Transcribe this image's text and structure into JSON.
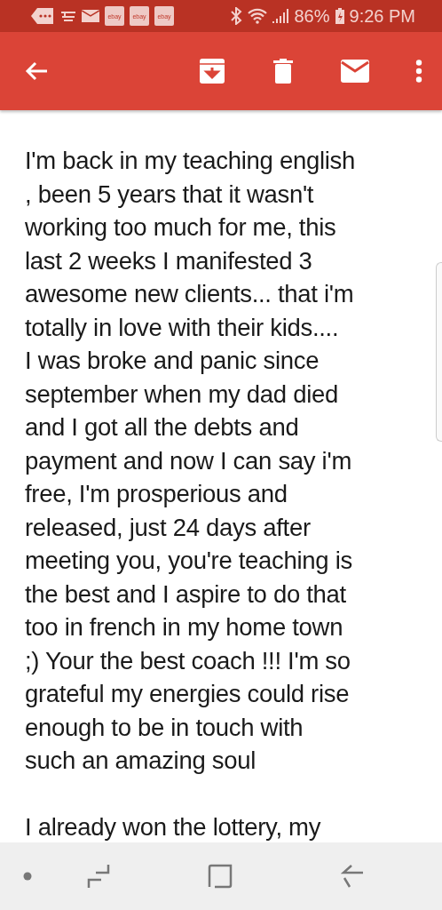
{
  "status_bar": {
    "notifications": [
      "ebay",
      "ebay",
      "ebay"
    ],
    "battery": "86%",
    "time": "9:26 PM"
  },
  "message": {
    "paragraphs": [
      {
        "lines": [
          "I'm back in my teaching english",
          ", been 5 years that it wasn't",
          "working too much for me, this",
          "last 2 weeks I manifested 3",
          "awesome new clients... that i'm",
          "totally in love with their kids....",
          "I was broke and panic since",
          "september when my dad died",
          "and I got all the debts and",
          "payment and now I can say i'm",
          "free, I'm prosperious and",
          "released, just 24 days after",
          "meeting you, you're teaching is",
          "the best and I aspire to do that",
          "too in french in my home town",
          ";) Your the best coach !!! I'm so",
          "grateful my energies could rise",
          "enough to be in touch with",
          "such an amazing soul"
        ]
      },
      {
        "lines": [
          "I already won the lottery, my"
        ]
      }
    ]
  }
}
